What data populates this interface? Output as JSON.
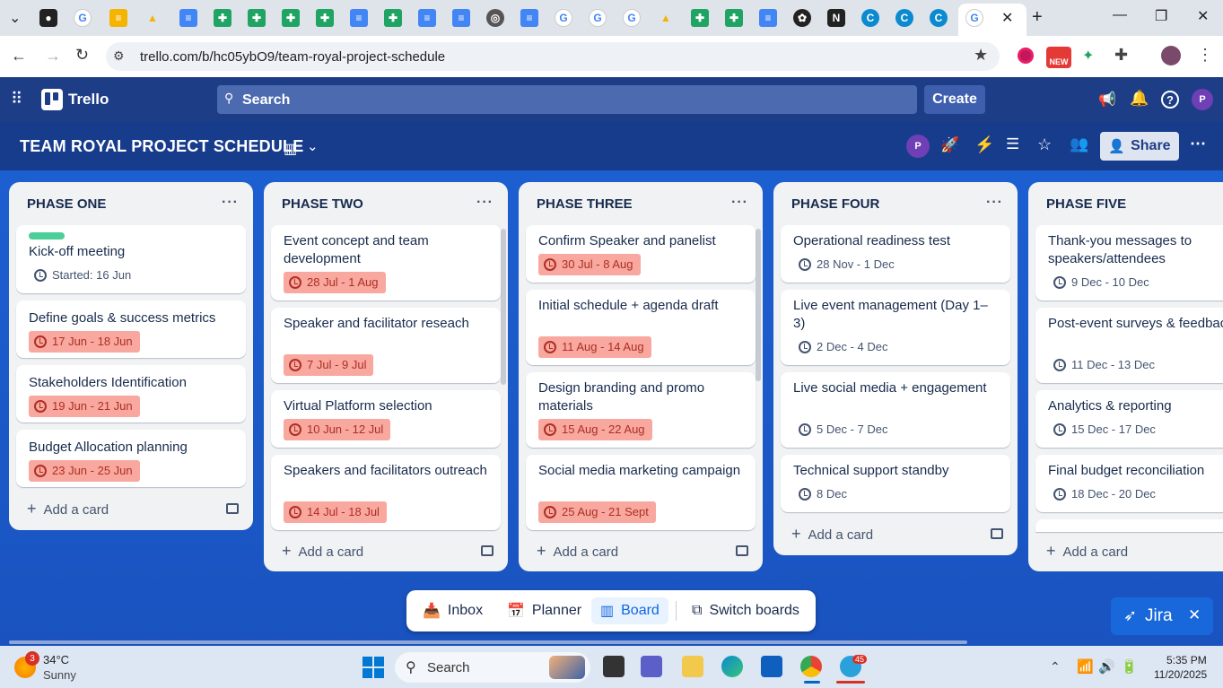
{
  "browser": {
    "url": "trello.com/b/hc05ybO9/team-royal-project-schedule",
    "new_badge": "NEW",
    "profile_initial": "P"
  },
  "trello": {
    "app_name": "Trello",
    "search_placeholder": "Search",
    "create_label": "Create",
    "profile_initial": "P"
  },
  "board": {
    "title": "TEAM ROYAL PROJECT SCHEDULE",
    "share_label": "Share",
    "member_initial": "P"
  },
  "lists": [
    {
      "title": "PHASE ONE",
      "cards": [
        {
          "title": "Kick-off meeting",
          "date": "Started: 16 Jun",
          "label_color": "#4bce97"
        },
        {
          "title": "Define goals & success metrics",
          "date": "17 Jun - 18 Jun"
        },
        {
          "title": "Stakeholders Identification",
          "date": "19 Jun - 21 Jun"
        },
        {
          "title": "Budget Allocation planning",
          "date": "23 Jun - 25 Jun"
        }
      ],
      "add_label": "Add a card"
    },
    {
      "title": "PHASE TWO",
      "cards": [
        {
          "title": "Event concept and team development",
          "date": "28 Jul - 1 Aug"
        },
        {
          "title": "Speaker and facilitator reseach",
          "date": "7 Jul - 9 Jul"
        },
        {
          "title": "Virtual Platform selection",
          "date": "10 Jun - 12 Jul"
        },
        {
          "title": "Speakers and facilitators outreach",
          "date": "14 Jul - 18 Jul"
        }
      ],
      "add_label": "Add a card"
    },
    {
      "title": "PHASE THREE",
      "cards": [
        {
          "title": "Confirm Speaker and panelist",
          "date": "30 Jul - 8 Aug"
        },
        {
          "title": "Initial schedule + agenda draft",
          "date": "11 Aug - 14 Aug"
        },
        {
          "title": "Design branding and promo materials",
          "date": "15 Aug - 22 Aug"
        },
        {
          "title": "Social media marketing campaign",
          "date": "25 Aug - 21 Sept"
        }
      ],
      "add_label": "Add a card"
    },
    {
      "title": "PHASE FOUR",
      "cards": [
        {
          "title": "Operational readiness test",
          "date": "28 Nov - 1 Dec"
        },
        {
          "title": "Live event management (Day 1–3)",
          "date": "2 Dec - 4 Dec"
        },
        {
          "title": "Live social media + engagement",
          "date": "5 Dec - 7 Dec"
        },
        {
          "title": "Technical support standby",
          "date": "8 Dec"
        }
      ],
      "add_label": "Add a card"
    },
    {
      "title": "PHASE FIVE",
      "cards": [
        {
          "title": "Thank-you messages to speakers/attendees",
          "date": "9 Dec - 10 Dec"
        },
        {
          "title": "Post-event surveys & feedback",
          "date": "11 Dec - 13 Dec"
        },
        {
          "title": "Analytics & reporting",
          "date": "15 Dec - 17 Dec"
        },
        {
          "title": "Final budget reconciliation",
          "date": "18 Dec - 20 Dec"
        }
      ],
      "add_label": "Add a card"
    }
  ],
  "bottom_nav": {
    "inbox": "Inbox",
    "planner": "Planner",
    "board": "Board",
    "switch": "Switch boards"
  },
  "jira": {
    "label": "Jira"
  },
  "taskbar": {
    "weather_temp": "34°C",
    "weather_desc": "Sunny",
    "weather_badge": "3",
    "search_label": "Search",
    "telegram_badge": "45",
    "time": "5:35 PM",
    "date": "11/20/2025"
  },
  "colors": {
    "header": "#1d3d86",
    "board_bg": "#1c5fd0",
    "overdue_bg": "#f8a89e",
    "overdue_text": "#ae2e24",
    "jira": "#1868db"
  }
}
